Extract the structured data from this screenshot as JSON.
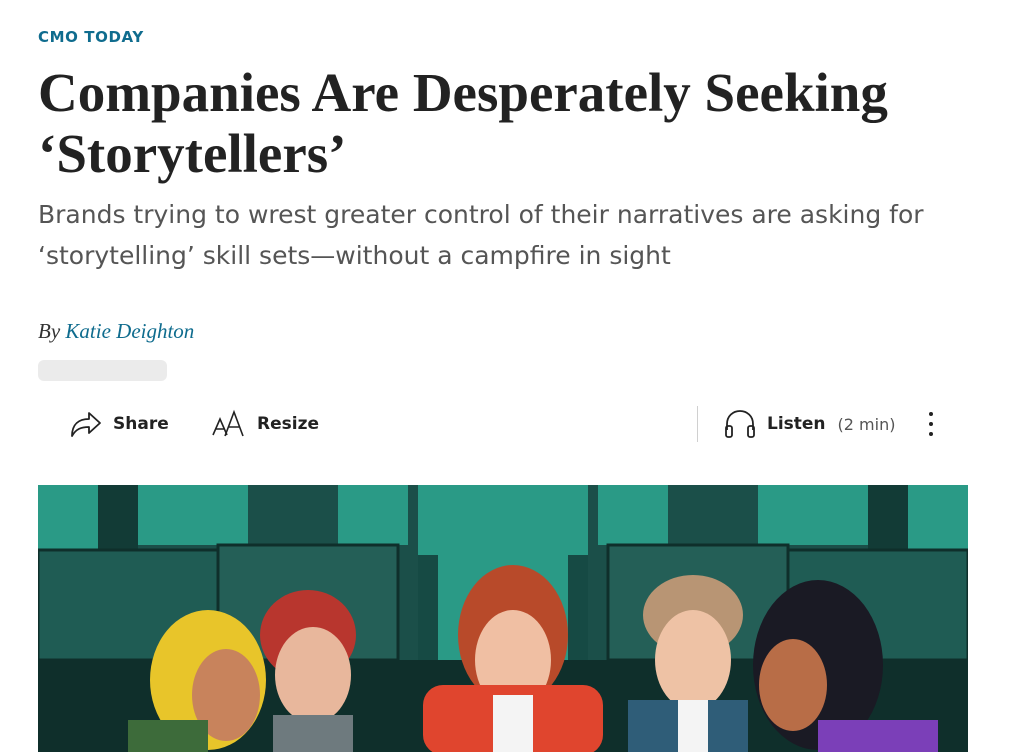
{
  "article": {
    "section": "CMO TODAY",
    "headline": "Companies Are Desperately Seeking ‘Storytellers’",
    "dek": "Brands trying to wrest greater control of their narratives are asking for ‘storytelling’ skill sets—without a campfire in sight",
    "byline_prefix": "By",
    "author": "Katie Deighton"
  },
  "toolbar": {
    "share_label": "Share",
    "resize_label": "Resize",
    "listen_label": "Listen",
    "listen_duration": "(2 min)",
    "icons": [
      "share-icon",
      "resize-icon",
      "headphones-icon",
      "more-options-icon"
    ]
  },
  "colors": {
    "accent": "#0f6c8e",
    "hero_teal": "#2a9a86",
    "hero_dark": "#123b36"
  }
}
